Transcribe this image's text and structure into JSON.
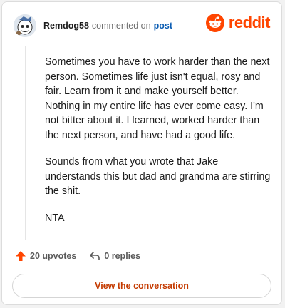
{
  "header": {
    "username": "Remdog58",
    "commented_on": "commented on",
    "post_link": "post",
    "logo_text": "reddit"
  },
  "comment": {
    "paragraphs": [
      "Sometimes you have to work harder than the next person. Sometimes life just isn't equal, rosy and fair. Learn from it and make yourself better. Nothing in my entire life has ever come easy. I'm not bitter about it. I learned, worked harder than the next person, and have had a good life.",
      "Sounds from what you wrote that Jake understands this but dad and grandma are stirring the shit.",
      "NTA"
    ]
  },
  "actions": {
    "upvotes": "20 upvotes",
    "replies": "0 replies"
  },
  "cta": {
    "label": "View the conversation"
  },
  "colors": {
    "brand": "#ff4500",
    "link": "#0b5db3",
    "cta_text": "#c43a00"
  },
  "icons": [
    "avatar",
    "reddit-logo-icon",
    "upvote-arrow-icon",
    "reply-icon"
  ]
}
